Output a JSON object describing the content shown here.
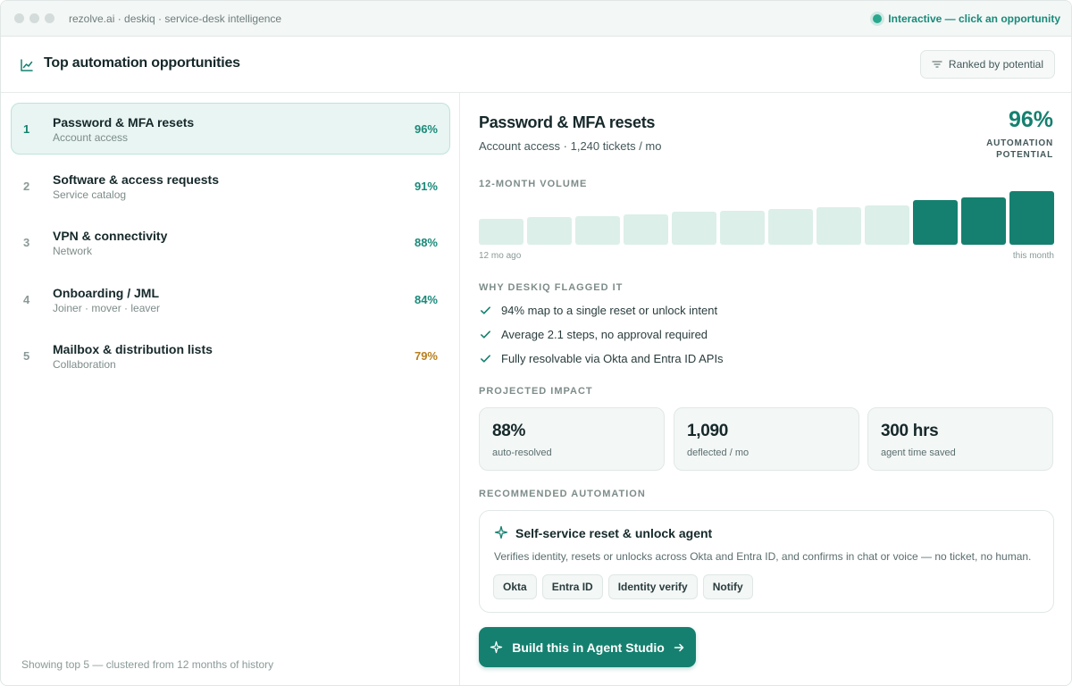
{
  "window": {
    "app_title": "rezolve.ai · deskiq · service-desk intelligence",
    "status_text": "Interactive — click an opportunity"
  },
  "header": {
    "title": "Top automation opportunities",
    "ranked_label": "Ranked by potential",
    "icon": "trend-chart-icon"
  },
  "opportunities": [
    {
      "rank": "1",
      "title": "Password & MFA resets",
      "subtitle": "Account access",
      "pct": "96%",
      "active": true
    },
    {
      "rank": "2",
      "title": "Software & access requests",
      "subtitle": "Service catalog",
      "pct": "91%",
      "active": false
    },
    {
      "rank": "3",
      "title": "VPN & connectivity",
      "subtitle": "Network",
      "pct": "88%",
      "active": false
    },
    {
      "rank": "4",
      "title": "Onboarding / JML",
      "subtitle": "Joiner · mover · leaver",
      "pct": "84%",
      "active": false
    },
    {
      "rank": "5",
      "title": "Mailbox & distribution lists",
      "subtitle": "Collaboration",
      "pct": "79%",
      "active": false
    }
  ],
  "left_footer": "Showing top 5 — clustered from 12 months of history",
  "detail": {
    "title": "Password & MFA resets",
    "subtitle": "Account access · 1,240 tickets / mo",
    "pct": "96%",
    "pct_label": "AUTOMATION POTENTIAL",
    "volume_label": "12-MONTH VOLUME",
    "axis_start": "12 mo ago",
    "axis_end": "this month",
    "why_label": "WHY DESKIQ FLAGGED IT",
    "reasons": [
      "94% map to a single reset or unlock intent",
      "Average 2.1 steps, no approval required",
      "Fully resolvable via Okta and Entra ID APIs"
    ],
    "impact_label": "PROJECTED IMPACT",
    "impact": [
      {
        "value": "88%",
        "label": "auto-resolved"
      },
      {
        "value": "1,090",
        "label": "deflected / mo"
      },
      {
        "value": "300 hrs",
        "label": "agent time saved"
      }
    ],
    "reco_label": "RECOMMENDED AUTOMATION",
    "reco_title": "Self-service reset & unlock agent",
    "reco_desc": "Verifies identity, resets or unlocks across Okta and Entra ID, and confirms in chat or voice — no ticket, no human.",
    "chips": [
      "Okta",
      "Entra ID",
      "Identity verify",
      "Notify"
    ],
    "build_label": "Build this in Agent Studio"
  },
  "chart_data": {
    "type": "bar",
    "values": [
      0.4,
      0.42,
      0.44,
      0.46,
      0.5,
      0.52,
      0.55,
      0.57,
      0.6,
      0.68,
      0.73,
      0.82
    ],
    "highlight_last": 3,
    "colors": {
      "muted": "#dcefe9",
      "highlight": "#15806f"
    }
  },
  "colors": {
    "accent": "#15806f",
    "amber": "#b8801f"
  }
}
